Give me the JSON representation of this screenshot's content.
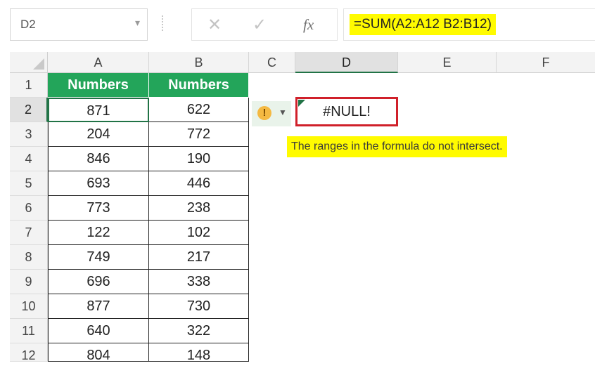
{
  "name_box": {
    "value": "D2",
    "dropdown_icon": "chevron-down-icon"
  },
  "formula_bar": {
    "cancel_icon": "close-icon",
    "enter_icon": "checkmark-icon",
    "fx_label": "fx",
    "formula": "=SUM(A2:A12 B2:B12)"
  },
  "columns": [
    "A",
    "B",
    "C",
    "D",
    "E",
    "F"
  ],
  "selected_column": "D",
  "rows": [
    "1",
    "2",
    "3",
    "4",
    "5",
    "6",
    "7",
    "8",
    "9",
    "10",
    "11",
    "12"
  ],
  "selected_row": "2",
  "table": {
    "headers": [
      "Numbers",
      "Numbers"
    ],
    "values": [
      [
        "871",
        "622"
      ],
      [
        "204",
        "772"
      ],
      [
        "846",
        "190"
      ],
      [
        "693",
        "446"
      ],
      [
        "773",
        "238"
      ],
      [
        "122",
        "102"
      ],
      [
        "749",
        "217"
      ],
      [
        "696",
        "338"
      ],
      [
        "877",
        "730"
      ],
      [
        "640",
        "322"
      ],
      [
        "804",
        "148"
      ]
    ]
  },
  "active_cell": {
    "ref": "D2",
    "value": "#NULL!"
  },
  "error_indicator": {
    "icon": "warning-icon",
    "dropdown_icon": "chevron-down-icon"
  },
  "error_tooltip": "The ranges in the formula do not intersect.",
  "colors": {
    "header_fill": "#23a55a",
    "highlight": "#fffb00",
    "error_box": "#d0202a",
    "selection": "#217346"
  }
}
